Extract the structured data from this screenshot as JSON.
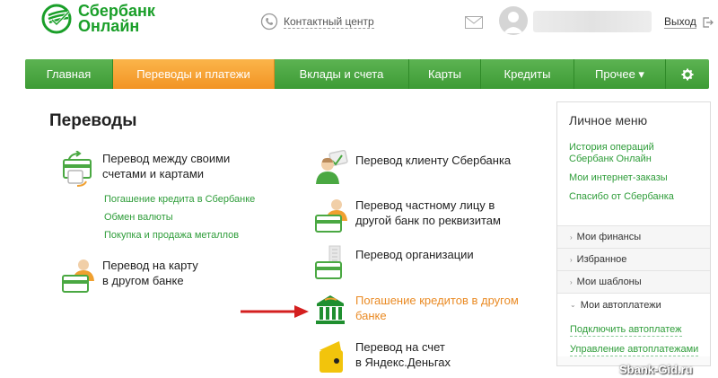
{
  "header": {
    "logo_line1": "Сбербанк",
    "logo_line2": "Онлайн",
    "contact_label": "Контактный центр",
    "exit_label": "Выход"
  },
  "nav": {
    "items": [
      {
        "label": "Главная",
        "active": false
      },
      {
        "label": "Переводы и платежи",
        "active": true
      },
      {
        "label": "Вклады и счета",
        "active": false
      },
      {
        "label": "Карты",
        "active": false
      },
      {
        "label": "Кредиты",
        "active": false
      },
      {
        "label": "Прочее ▾",
        "active": false
      }
    ]
  },
  "main": {
    "title": "Переводы",
    "left_items": [
      {
        "line1": "Перевод между своими",
        "line2": "счетами и картами"
      },
      {
        "line1": "Перевод на карту",
        "line2": "в другом банке"
      }
    ],
    "sub_links": [
      "Погашение кредита в Сбербанке",
      "Обмен валюты",
      "Покупка и продажа металлов"
    ],
    "right_items": [
      {
        "line1": "Перевод клиенту Сбербанка",
        "line2": ""
      },
      {
        "line1": "Перевод частному лицу в",
        "line2": "другой банк по реквизитам"
      },
      {
        "line1": "Перевод организации",
        "line2": ""
      },
      {
        "line1": "Погашение кредитов в другом",
        "line2": "банке"
      },
      {
        "line1": "Перевод на счет",
        "line2": "в Яндекс.Деньгах"
      }
    ]
  },
  "sidebar": {
    "title": "Личное меню",
    "links": [
      "История операций",
      "Сбербанк Онлайн",
      "Мои интернет-заказы",
      "Спасибо от Сбербанка"
    ],
    "sections": [
      "Мои финансы",
      "Избранное",
      "Мои шаблоны",
      "Мои автоплатежи"
    ],
    "auto_links": [
      "Подключить автоплатеж",
      "Управление автоплатежами"
    ]
  },
  "watermark": "Sbank-Gid.ru",
  "colors": {
    "brand_green": "#1a9f29",
    "nav_green": "#4aa842",
    "nav_active": "#f5a030",
    "link_green": "#2f9d3a",
    "arrow_red": "#d41f1f"
  }
}
